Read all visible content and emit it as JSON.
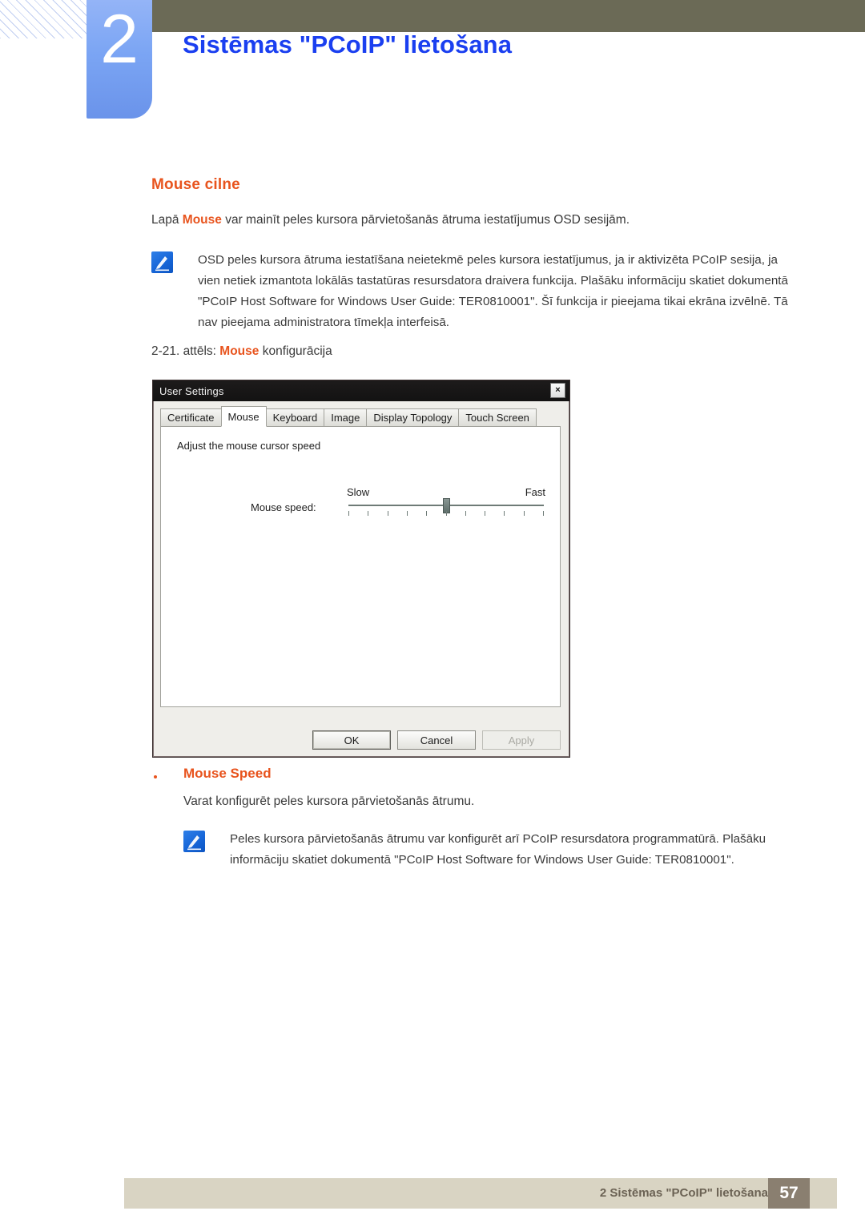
{
  "header": {
    "chapter_number": "2",
    "chapter_title": "Sistēmas \"PCoIP\" lietošana",
    "olive_color": "#6b6a56",
    "badge_color": "#7ba5f4",
    "title_color": "#1a3ff0"
  },
  "section": {
    "heading": "Mouse cilne",
    "heading_color": "#e8541e",
    "intro_before": "Lapā ",
    "intro_keyword": "Mouse",
    "intro_after": " var mainīt peles kursora pārvietošanās ātruma iestatījumus OSD sesijām."
  },
  "note1": {
    "icon": "note-pencil-icon",
    "text": "OSD peles kursora ātruma iestatīšana neietekmē peles kursora iestatījumus, ja ir aktivizēta PCoIP sesija, ja vien netiek izmantota lokālās tastatūras resursdatora draivera funkcija. Plašāku informāciju skatiet dokumentā \"PCoIP Host Software for Windows User Guide: TER0810001\". Šī funkcija ir pieejama tikai ekrāna izvēlnē. Tā nav pieejama administratora tīmekļa interfeisā."
  },
  "figure": {
    "caption_before": "2-21. attēls: ",
    "caption_keyword": "Mouse",
    "caption_after": " konfigurācija"
  },
  "dialog": {
    "title": "User Settings",
    "close_label": "×",
    "tabs": [
      {
        "label": "Certificate",
        "active": false
      },
      {
        "label": "Mouse",
        "active": true
      },
      {
        "label": "Keyboard",
        "active": false
      },
      {
        "label": "Image",
        "active": false
      },
      {
        "label": "Display Topology",
        "active": false
      },
      {
        "label": "Touch Screen",
        "active": false
      }
    ],
    "panel_label": "Adjust the mouse cursor speed",
    "speed_label": "Mouse speed:",
    "slider": {
      "min_label": "Slow",
      "max_label": "Fast",
      "tick_count": 11,
      "value_index": 5
    },
    "buttons": [
      {
        "label": "OK",
        "state": "default"
      },
      {
        "label": "Cancel",
        "state": "enabled"
      },
      {
        "label": "Apply",
        "state": "disabled"
      }
    ]
  },
  "bullet": {
    "label": "Mouse Speed",
    "description": "Varat konfigurēt peles kursora pārvietošanās ātrumu."
  },
  "note2": {
    "icon": "note-pencil-icon",
    "text": "Peles kursora pārvietošanās ātrumu var konfigurēt arī PCoIP resursdatora programmatūrā. Plašāku informāciju skatiet dokumentā \"PCoIP Host Software for Windows User Guide: TER0810001\"."
  },
  "footer": {
    "text": "2 Sistēmas \"PCoIP\" lietošana",
    "page_number": "57",
    "bar_color": "#d9d4c3",
    "page_box_color": "#8a7f70"
  }
}
